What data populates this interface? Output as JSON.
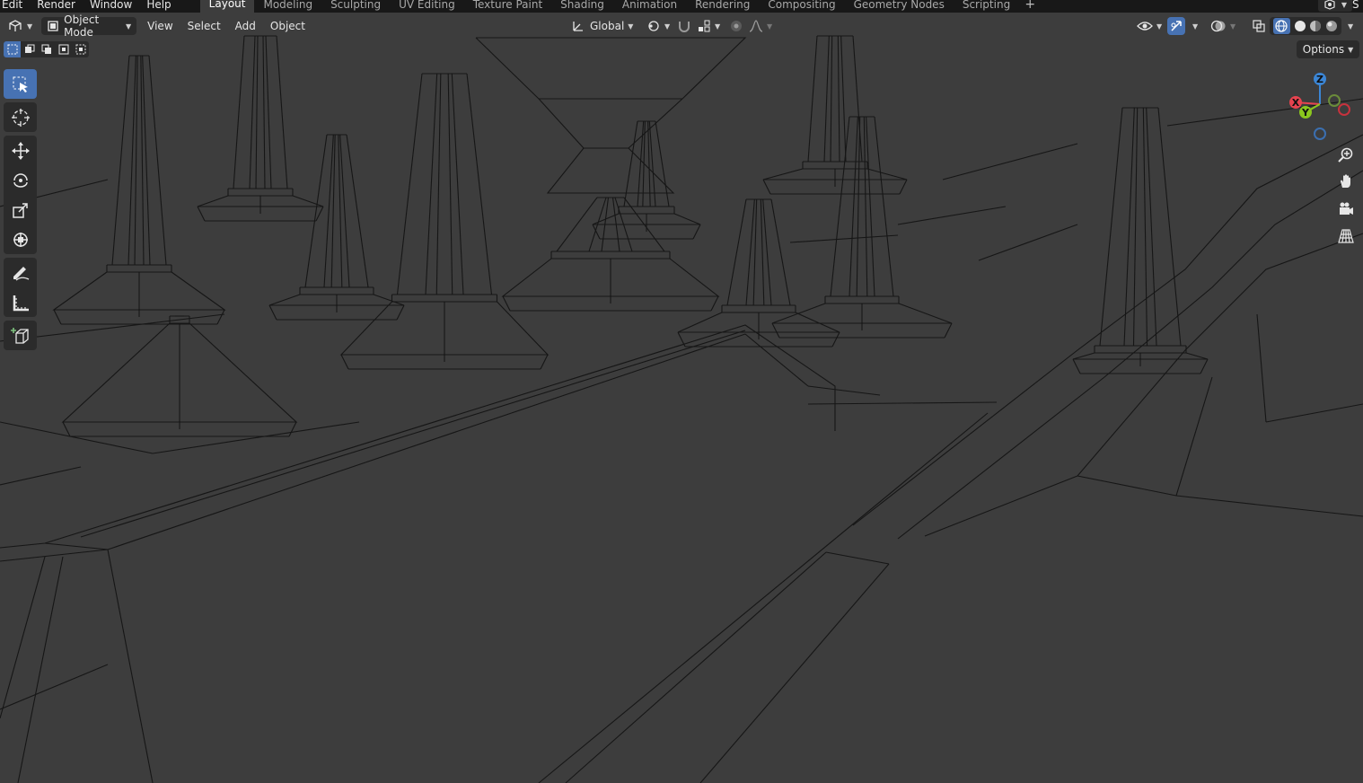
{
  "menu": {
    "items": [
      "Edit",
      "Render",
      "Window",
      "Help"
    ]
  },
  "workspaces": {
    "tabs": [
      "Layout",
      "Modeling",
      "Sculpting",
      "UV Editing",
      "Texture Paint",
      "Shading",
      "Animation",
      "Rendering",
      "Compositing",
      "Geometry Nodes",
      "Scripting"
    ],
    "active": "Layout",
    "add_label": "+"
  },
  "scene_letter": "S",
  "header": {
    "mode": "Object Mode",
    "menus": [
      "View",
      "Select",
      "Add",
      "Object"
    ],
    "transform_orientation": "Global"
  },
  "viewport": {
    "options_label": "Options",
    "gizmo_axes": {
      "z": "Z",
      "x": "X",
      "y": "Y"
    },
    "background_color": "#3d3d3d",
    "wire_color": "#1a1a1a"
  },
  "colors": {
    "accent": "#4772b3",
    "axis_x": "#e7434f",
    "axis_y": "#8bc71e",
    "axis_z": "#3b86d6"
  },
  "icons": {
    "tools": [
      "select-box-icon",
      "cursor-icon",
      "move-icon",
      "rotate-icon",
      "scale-icon",
      "transform-icon",
      "annotate-icon",
      "measure-icon",
      "add-cube-icon"
    ],
    "nav": [
      "zoom-icon",
      "pan-hand-icon",
      "camera-icon",
      "grid-view-icon"
    ]
  }
}
